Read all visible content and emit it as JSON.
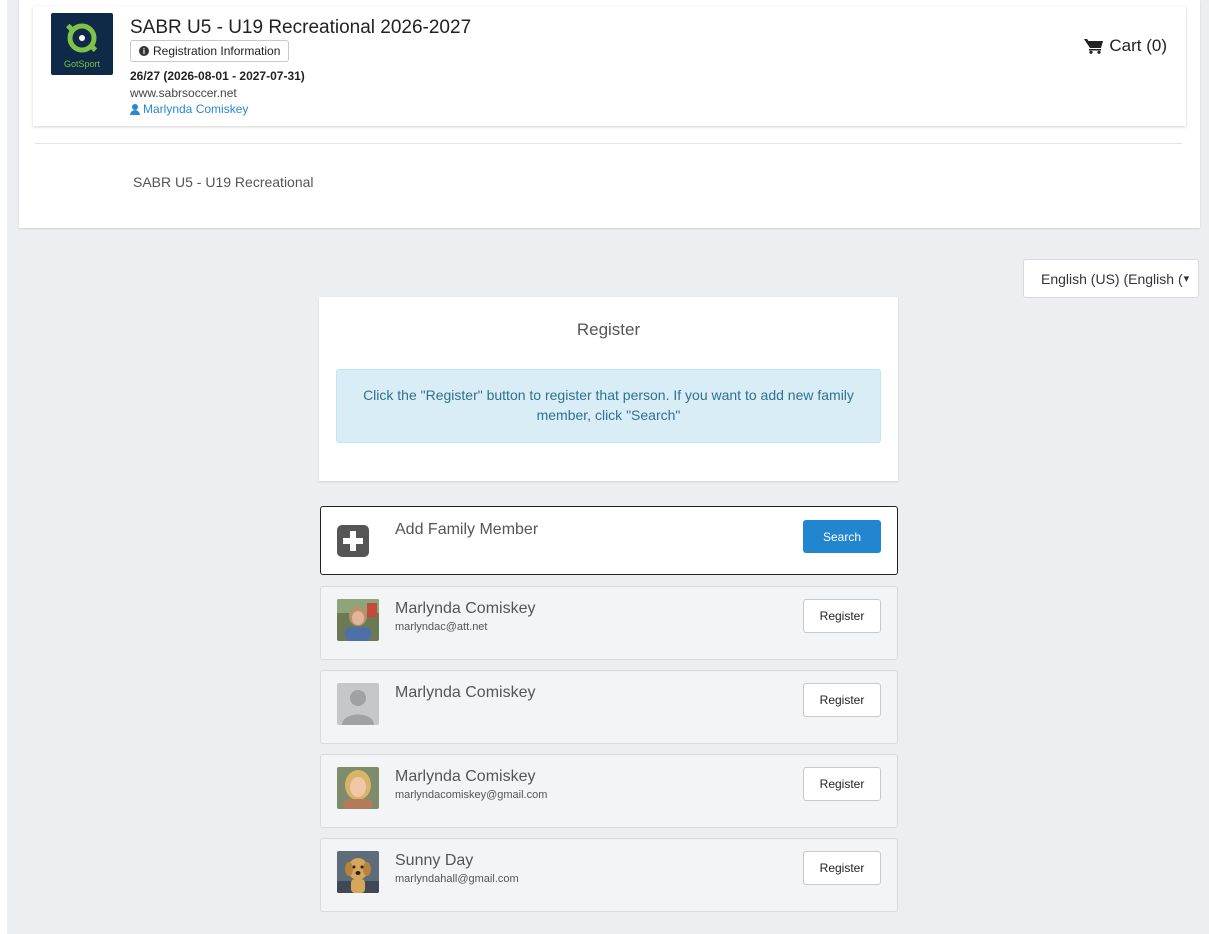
{
  "event": {
    "title": "SABR U5 - U19 Recreational 2026-2027",
    "registration_info_label": "Registration Information",
    "season": "26/27 (2026-08-01 - 2027-07-31)",
    "website": "www.sabrsoccer.net",
    "contact": "Marlynda Comiskey",
    "logo_text": "GotSport"
  },
  "cart": {
    "label": "Cart (0)"
  },
  "program": {
    "name": "SABR U5 - U19 Recreational"
  },
  "language": {
    "selected": "English (US) (English ("
  },
  "register": {
    "title": "Register",
    "instructions": "Click the \"Register\" button to register that person. If you want to add new family member, click \"Search\""
  },
  "add_member": {
    "label": "Add Family Member",
    "button": "Search"
  },
  "members": [
    {
      "name": "Marlynda Comiskey",
      "email": "marlyndac@att.net",
      "button": "Register",
      "avatar": "photo-woman-outdoors"
    },
    {
      "name": "Marlynda Comiskey",
      "email": "",
      "button": "Register",
      "avatar": "default-silhouette"
    },
    {
      "name": "Marlynda Comiskey",
      "email": "marlyndacomiskey@gmail.com",
      "button": "Register",
      "avatar": "photo-woman-blonde"
    },
    {
      "name": "Sunny Day",
      "email": "marlyndahall@gmail.com",
      "button": "Register",
      "avatar": "photo-puppy"
    }
  ],
  "colors": {
    "primary_button": "#2185d0",
    "link": "#2b87d1",
    "alert_bg": "#d9edf7",
    "alert_text": "#31708f",
    "logo_bg": "#0e2a48",
    "logo_accent": "#7ec247"
  }
}
